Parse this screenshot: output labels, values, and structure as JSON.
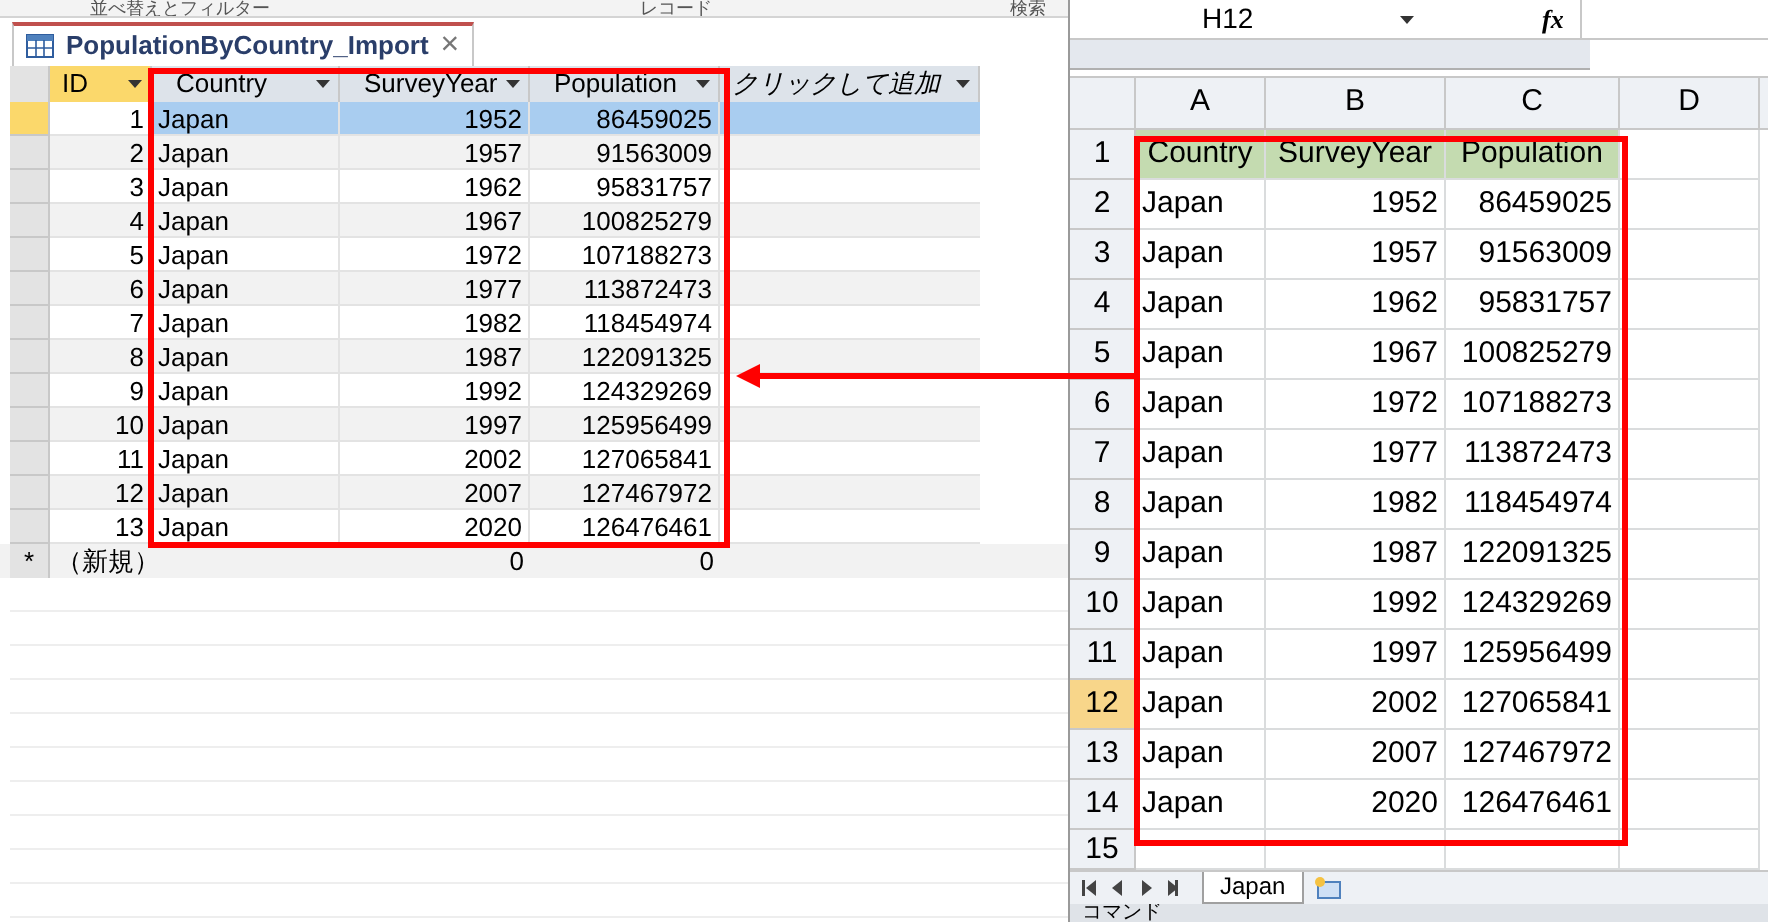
{
  "access": {
    "ribbon_groups": [
      "並べ替えとフィルター",
      "レコード",
      "検索"
    ],
    "tab": {
      "title": "PopulationByCountry_Import",
      "close": "×"
    },
    "columns": [
      {
        "label": "ID",
        "kind": "key"
      },
      {
        "label": "Country",
        "kind": "field"
      },
      {
        "label": "SurveyYear",
        "kind": "field"
      },
      {
        "label": "Population",
        "kind": "field"
      },
      {
        "label": "クリックして追加",
        "kind": "add"
      }
    ],
    "rows": [
      {
        "cells": [
          "1",
          "Japan",
          "1952",
          "86459025"
        ],
        "selected": true
      },
      {
        "cells": [
          "2",
          "Japan",
          "1957",
          "91563009"
        ],
        "selected": false
      },
      {
        "cells": [
          "3",
          "Japan",
          "1962",
          "95831757"
        ],
        "selected": false
      },
      {
        "cells": [
          "4",
          "Japan",
          "1967",
          "100825279"
        ],
        "selected": false
      },
      {
        "cells": [
          "5",
          "Japan",
          "1972",
          "107188273"
        ],
        "selected": false
      },
      {
        "cells": [
          "6",
          "Japan",
          "1977",
          "113872473"
        ],
        "selected": false
      },
      {
        "cells": [
          "7",
          "Japan",
          "1982",
          "118454974"
        ],
        "selected": false
      },
      {
        "cells": [
          "8",
          "Japan",
          "1987",
          "122091325"
        ],
        "selected": false
      },
      {
        "cells": [
          "9",
          "Japan",
          "1992",
          "124329269"
        ],
        "selected": false
      },
      {
        "cells": [
          "10",
          "Japan",
          "1997",
          "125956499"
        ],
        "selected": false
      },
      {
        "cells": [
          "11",
          "Japan",
          "2002",
          "127065841"
        ],
        "selected": false
      },
      {
        "cells": [
          "12",
          "Japan",
          "2007",
          "127467972"
        ],
        "selected": false
      },
      {
        "cells": [
          "13",
          "Japan",
          "2020",
          "126476461"
        ],
        "selected": false
      }
    ],
    "new_row": {
      "marker": "*",
      "cells": [
        "（新規）",
        "0",
        "0"
      ]
    }
  },
  "excel": {
    "name_box": "H12",
    "fx": "fx",
    "columns": [
      "A",
      "B",
      "C",
      "D"
    ],
    "rows": [
      {
        "number": "1",
        "cells": [
          "Country",
          "SurveyYear",
          "Population"
        ],
        "kind": "header",
        "selected": false
      },
      {
        "number": "2",
        "cells": [
          "Japan",
          "1952",
          "86459025"
        ],
        "kind": "data",
        "selected": false
      },
      {
        "number": "3",
        "cells": [
          "Japan",
          "1957",
          "91563009"
        ],
        "kind": "data",
        "selected": false
      },
      {
        "number": "4",
        "cells": [
          "Japan",
          "1962",
          "95831757"
        ],
        "kind": "data",
        "selected": false
      },
      {
        "number": "5",
        "cells": [
          "Japan",
          "1967",
          "100825279"
        ],
        "kind": "data",
        "selected": false
      },
      {
        "number": "6",
        "cells": [
          "Japan",
          "1972",
          "107188273"
        ],
        "kind": "data",
        "selected": false
      },
      {
        "number": "7",
        "cells": [
          "Japan",
          "1977",
          "113872473"
        ],
        "kind": "data",
        "selected": false
      },
      {
        "number": "8",
        "cells": [
          "Japan",
          "1982",
          "118454974"
        ],
        "kind": "data",
        "selected": false
      },
      {
        "number": "9",
        "cells": [
          "Japan",
          "1987",
          "122091325"
        ],
        "kind": "data",
        "selected": false
      },
      {
        "number": "10",
        "cells": [
          "Japan",
          "1992",
          "124329269"
        ],
        "kind": "data",
        "selected": false
      },
      {
        "number": "11",
        "cells": [
          "Japan",
          "1997",
          "125956499"
        ],
        "kind": "data",
        "selected": false
      },
      {
        "number": "12",
        "cells": [
          "Japan",
          "2002",
          "127065841"
        ],
        "kind": "data",
        "selected": true
      },
      {
        "number": "13",
        "cells": [
          "Japan",
          "2007",
          "127467972"
        ],
        "kind": "data",
        "selected": false
      },
      {
        "number": "14",
        "cells": [
          "Japan",
          "2020",
          "126476461"
        ],
        "kind": "data",
        "selected": false
      },
      {
        "number": "15",
        "cells": [],
        "kind": "empty",
        "selected": false
      }
    ],
    "sheet_tab": "Japan",
    "status": "コマンド"
  }
}
